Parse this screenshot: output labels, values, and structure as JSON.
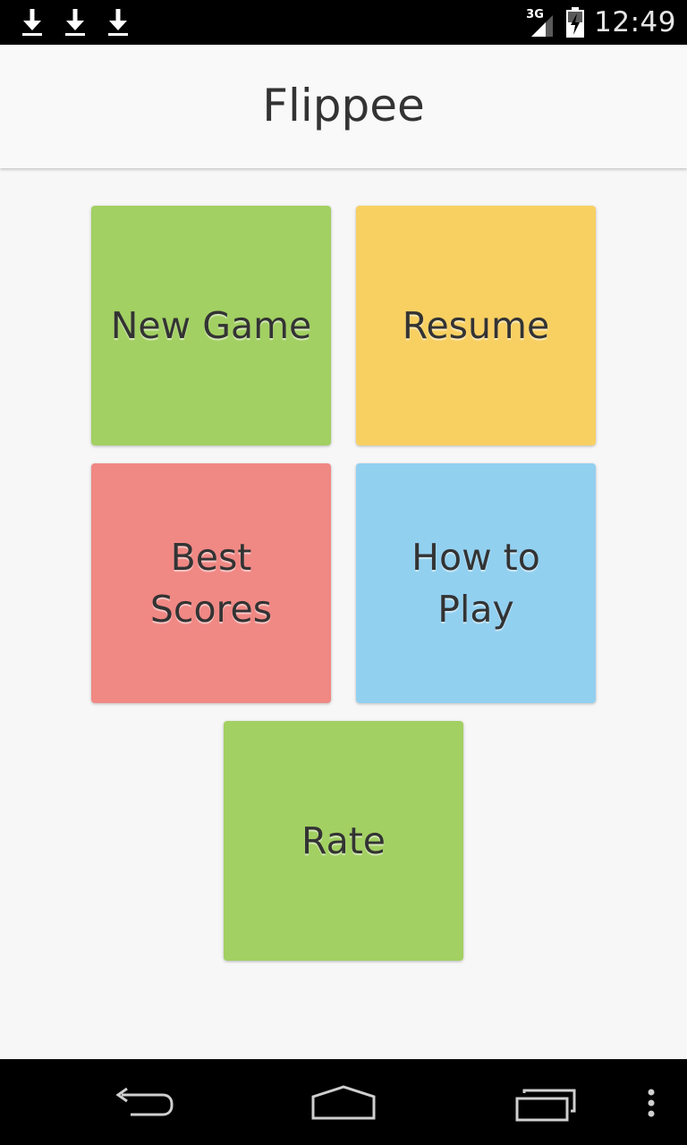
{
  "status_bar": {
    "time": "12:49",
    "network": "3G",
    "icons": [
      "download-icon",
      "download-icon",
      "download-icon",
      "signal-icon",
      "battery-charging-icon"
    ]
  },
  "app_bar": {
    "title": "Flippee"
  },
  "menu": {
    "new_game": {
      "label": "New Game",
      "color": "#a2d062"
    },
    "resume": {
      "label": "Resume",
      "color": "#f8d062"
    },
    "best_scores": {
      "label": "Best\nScores",
      "color": "#f08884"
    },
    "how_to_play": {
      "label": "How to\nPlay",
      "color": "#92d0f0"
    },
    "rate": {
      "label": "Rate",
      "color": "#a2d062"
    }
  },
  "nav_bar": {
    "icons": [
      "back-icon",
      "home-icon",
      "recent-apps-icon",
      "overflow-menu-icon"
    ]
  }
}
